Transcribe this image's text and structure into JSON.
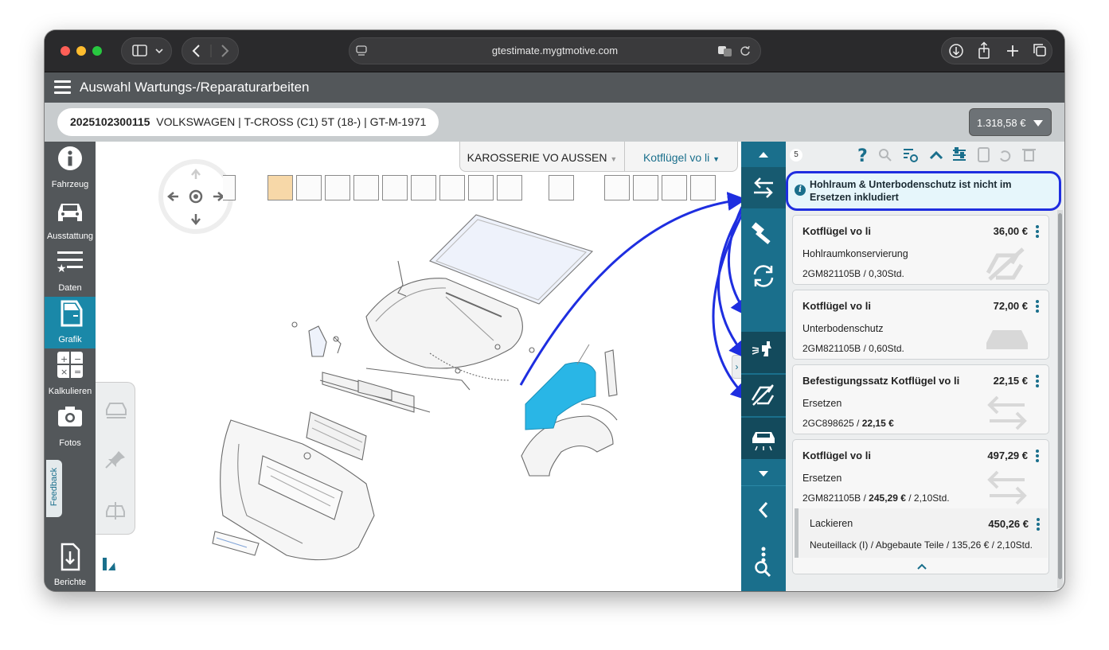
{
  "browser": {
    "url": "gtestimate.mygtmotive.com"
  },
  "app": {
    "title": "Auswahl Wartungs-/Reparaturarbeiten"
  },
  "vehicle": {
    "id": "2025102300115",
    "description": "VOLKSWAGEN | T-CROSS (C1) 5T (18-) | GT-M-1971"
  },
  "total": "1.318,58 €",
  "nav": {
    "items": [
      {
        "label": "Fahrzeug",
        "icon": "info-icon"
      },
      {
        "label": "Ausstattung",
        "icon": "car-icon"
      },
      {
        "label": "Daten",
        "icon": "list-star-icon"
      },
      {
        "label": "Grafik",
        "icon": "door-icon"
      },
      {
        "label": "Kalkulieren",
        "icon": "calculator-icon"
      },
      {
        "label": "Fotos",
        "icon": "camera-icon"
      },
      {
        "label": "Berichte",
        "icon": "download-doc-icon"
      }
    ],
    "active": "Grafik",
    "feedback": "Feedback"
  },
  "graphic": {
    "group": "KAROSSERIE VO AUSSEN",
    "part": "Kotflügel vo li",
    "selected_part_color": "#29b6e6"
  },
  "panel": {
    "count": "5",
    "notice": "Hohlraum & Unterbodenschutz ist nicht im Ersetzen inkludiert",
    "items": [
      {
        "title": "Kotflügel vo li",
        "price": "36,00 €",
        "operation": "Hohlraumkonservierung",
        "code": "2GM821105B / 0,30Std.",
        "watermark": "paint-slash-icon"
      },
      {
        "title": "Kotflügel vo li",
        "price": "72,00 €",
        "operation": "Unterbodenschutz",
        "code": "2GM821105B / 0,60Std.",
        "watermark": "underbody-car-icon"
      },
      {
        "title": "Befestigungssatz Kotflügel vo li",
        "price": "22,15 €",
        "operation": "Ersetzen",
        "code_pre": "2GC898625 / ",
        "code_bold": "22,15 €",
        "watermark": "swap-arrows-icon"
      },
      {
        "title": "Kotflügel vo li",
        "price": "497,29 €",
        "operation": "Ersetzen",
        "code_pre": "2GM821105B / ",
        "code_bold": "245,29 €",
        "code_post": " / 2,10Std.",
        "watermark": "swap-arrows-icon"
      }
    ],
    "subitem": {
      "title": "Lackieren",
      "price": "450,26 €",
      "detail": "Neuteillack (I) / Abgebaute Teile / 135,26 € / 2,10Std."
    }
  },
  "colors": {
    "accent": "#1a6f8c",
    "annotation_arrows": "#1e2ee0"
  }
}
